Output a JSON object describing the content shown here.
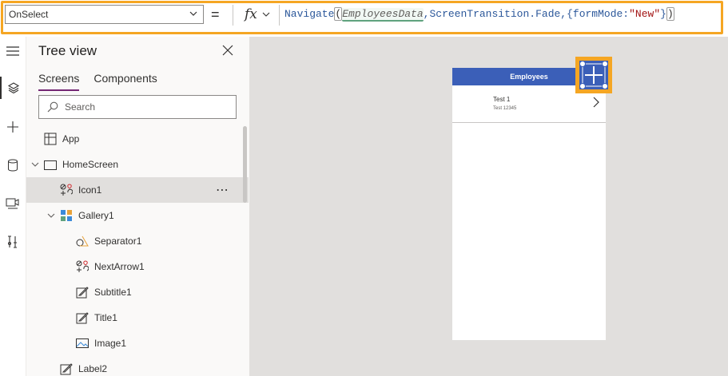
{
  "formula_bar": {
    "property": "OnSelect",
    "equals": "=",
    "fx_label": "fx",
    "formula": {
      "func": "Navigate",
      "open_paren": "(",
      "arg1": "EmployeesData",
      "comma1": ",",
      "arg2": "ScreenTransition.Fade",
      "comma2": ",{formMode:",
      "str": "\"New\"",
      "close_brace": "}",
      "close_paren": ")"
    }
  },
  "left_rail": {
    "items": [
      "hamburger-icon",
      "layers-icon",
      "plus-icon",
      "database-icon",
      "media-icon",
      "tools-icon"
    ]
  },
  "tree_view": {
    "title": "Tree view",
    "tabs": [
      {
        "label": "Screens",
        "active": true
      },
      {
        "label": "Components",
        "active": false
      }
    ],
    "search_placeholder": "Search",
    "items": [
      {
        "label": "App",
        "icon": "app-icon",
        "level": 0,
        "expandable": false
      },
      {
        "label": "HomeScreen",
        "icon": "screen-icon",
        "level": 0,
        "expandable": true
      },
      {
        "label": "Icon1",
        "icon": "icon-control-icon",
        "level": 1,
        "expandable": false,
        "selected": true,
        "more": "⋯"
      },
      {
        "label": "Gallery1",
        "icon": "gallery-icon",
        "level": 1,
        "expandable": true
      },
      {
        "label": "Separator1",
        "icon": "shape-icon",
        "level": 2,
        "expandable": false
      },
      {
        "label": "NextArrow1",
        "icon": "icon-control-icon",
        "level": 2,
        "expandable": false
      },
      {
        "label": "Subtitle1",
        "icon": "label-icon",
        "level": 2,
        "expandable": false
      },
      {
        "label": "Title1",
        "icon": "label-icon",
        "level": 2,
        "expandable": false
      },
      {
        "label": "Image1",
        "icon": "image-icon",
        "level": 2,
        "expandable": false
      },
      {
        "label": "Label2",
        "icon": "label-icon",
        "level": 1,
        "expandable": false
      }
    ]
  },
  "canvas": {
    "screen_title": "Employees",
    "gallery": {
      "title": "Test 1",
      "subtitle": "Test 12345"
    }
  },
  "colors": {
    "accent_highlight": "#f5a623",
    "header_blue": "#3b5fb8",
    "tab_underline": "#742774"
  }
}
